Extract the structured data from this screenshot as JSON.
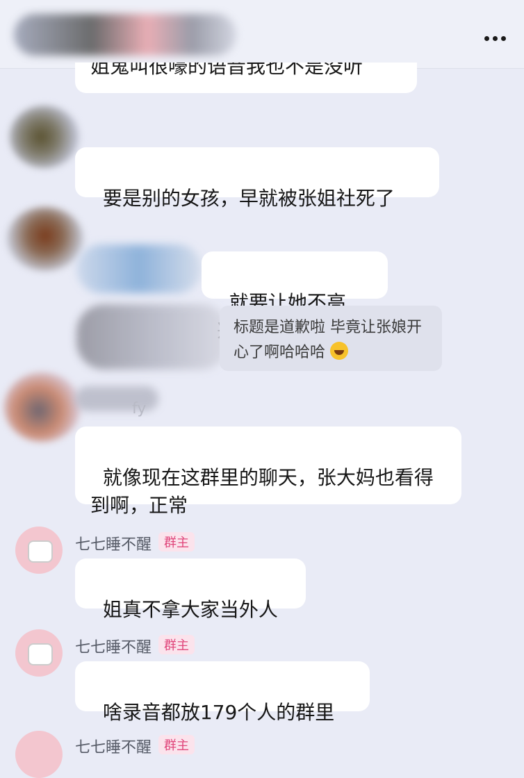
{
  "header": {
    "menu_icon": "more-icon"
  },
  "messages": [
    {
      "text": "姐鬼叫很嚎的语音我也不是没听"
    },
    {
      "text": "要是别的女孩，早就被张姐社死了"
    },
    {
      "text": "就要让她不高兴。"
    },
    {
      "quote": "标题是道歉啦 毕竟让张娘开心了啊哈哈哈",
      "emoji": "rofl-emoji"
    },
    {
      "sender_hint": "fy",
      "text": "就像现在这群里的聊天，张大妈也看得到啊，正常"
    },
    {
      "sender": "七七睡不醒",
      "badge": "群主",
      "text": "姐真不拿大家当外人"
    },
    {
      "sender": "七七睡不醒",
      "badge": "群主",
      "text": "啥录音都放179个人的群里"
    },
    {
      "sender": "七七睡不醒",
      "badge": "群主"
    }
  ],
  "colors": {
    "background": "#e9ebf6",
    "bubble": "#ffffff",
    "badge_text": "#e0457a",
    "badge_bg": "#fbe3ec"
  }
}
